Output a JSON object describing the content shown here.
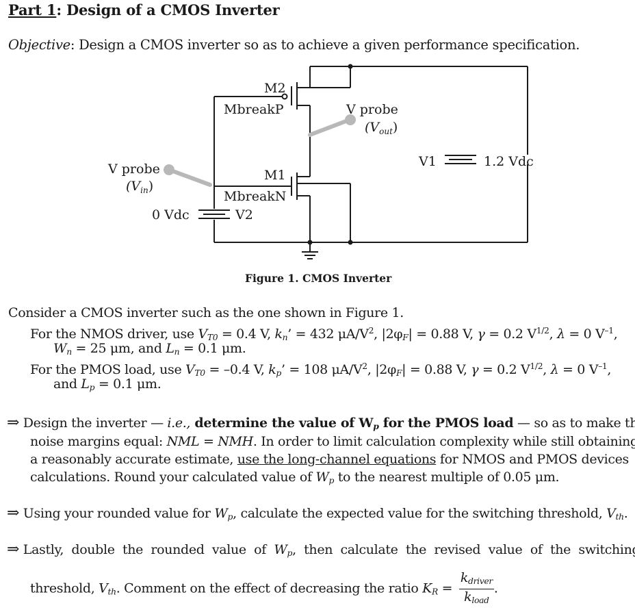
{
  "header": {
    "part": "Part 1",
    "title_rest": ": Design of a CMOS Inverter"
  },
  "objective": {
    "label": "Objective",
    "text": ":  Design a CMOS inverter so as to achieve a given performance specification."
  },
  "figure": {
    "caption": "Figure 1.  CMOS Inverter",
    "labels": {
      "m2": "M2",
      "mbreakp": "MbreakP",
      "m1": "M1",
      "mbreakn": "MbreakN",
      "vprobe_out": "V probe",
      "vout": "(V",
      "vout_sub": "out",
      "vprobe_in": "V probe",
      "vin": "(V",
      "vin_sub": "in",
      "v1": "V1",
      "v1_value": "1.2 Vdc",
      "v2": "V2",
      "v2_value": "0 Vdc"
    }
  },
  "body": {
    "intro": "Consider a CMOS inverter such as the one shown in Figure 1.",
    "nmos": {
      "prefix": "For the NMOS driver, use ",
      "vt0": " = 0.4 V, ",
      "kn": " = 432 μA/V",
      "phi": " = 0.88 V, ",
      "gamma": " = 0.2 V",
      "lambda": " = 0 V",
      "wn": " = 25 μm, and ",
      "ln": " = 0.1 μm."
    },
    "pmos": {
      "prefix": "For the PMOS load, use ",
      "vt0": " = –0.4 V, ",
      "kp": " = 108 μA/V",
      "phi": " = 0.88 V, ",
      "gamma": " = 0.2 V",
      "lambda": " = 0 V",
      "lp_prefix": "and ",
      "lp": " = 0.1 μm."
    }
  },
  "tasks": [
    {
      "arrow": "⇒",
      "line1_a": "Design the inverter — ",
      "line1_ie": "i.e.,",
      "line1_bold": " determine the value of W",
      "line1_bold_sub": "p",
      "line1_bold2": " for the PMOS load",
      "line1_b": " — so as to make the",
      "line2_a": "noise margins equal:  ",
      "line2_nml": "NML",
      "line2_eq": " = ",
      "line2_nmh": "NMH",
      "line2_b": ".  In order to limit calculation complexity while still obtaining",
      "line3_a": "a reasonably accurate estimate, ",
      "line3_ul": "use the long-channel equations",
      "line3_b": " for NMOS and PMOS devices",
      "line4_a": "calculations.  Round your calculated value of ",
      "line4_b": " to the nearest multiple of 0.05 μm."
    },
    {
      "arrow": "⇒",
      "text_a": "Using your rounded value for ",
      "text_b": ", calculate the expected value for the switching threshold, "
    },
    {
      "arrow": "⇒",
      "line1_a": "Lastly,  double  the  rounded  value  of  ",
      "line1_b": ",  then  calculate  the  revised  value  of  the  switching",
      "line2_a": "threshold, ",
      "line2_b": ".  Comment on the effect of decreasing the ratio ",
      "kr": "K",
      "kr_sub": "R",
      "eq": " = ",
      "num": "k",
      "num_sub": "driver",
      "den": "k",
      "den_sub": "load",
      "end": "."
    }
  ],
  "symbols": {
    "vt0": "V",
    "vt0_sub": "T0",
    "kn": "k",
    "kn_sub": "n",
    "prime": "’",
    "sq": "2",
    "phi": "|2φ",
    "phi_sub": "F",
    "phi_end": "|",
    "gamma": "γ",
    "half": "1/2",
    "lambda": "λ",
    "neg1": "–1",
    "wn": "W",
    "wn_sub": "n",
    "ln": "L",
    "ln_sub": "n",
    "kp_sub": "p",
    "lp": "L",
    "lp_sub": "p",
    "wp": "W",
    "wp_sub": "p",
    "vth": "V",
    "vth_sub": "th",
    "comma": ", "
  }
}
